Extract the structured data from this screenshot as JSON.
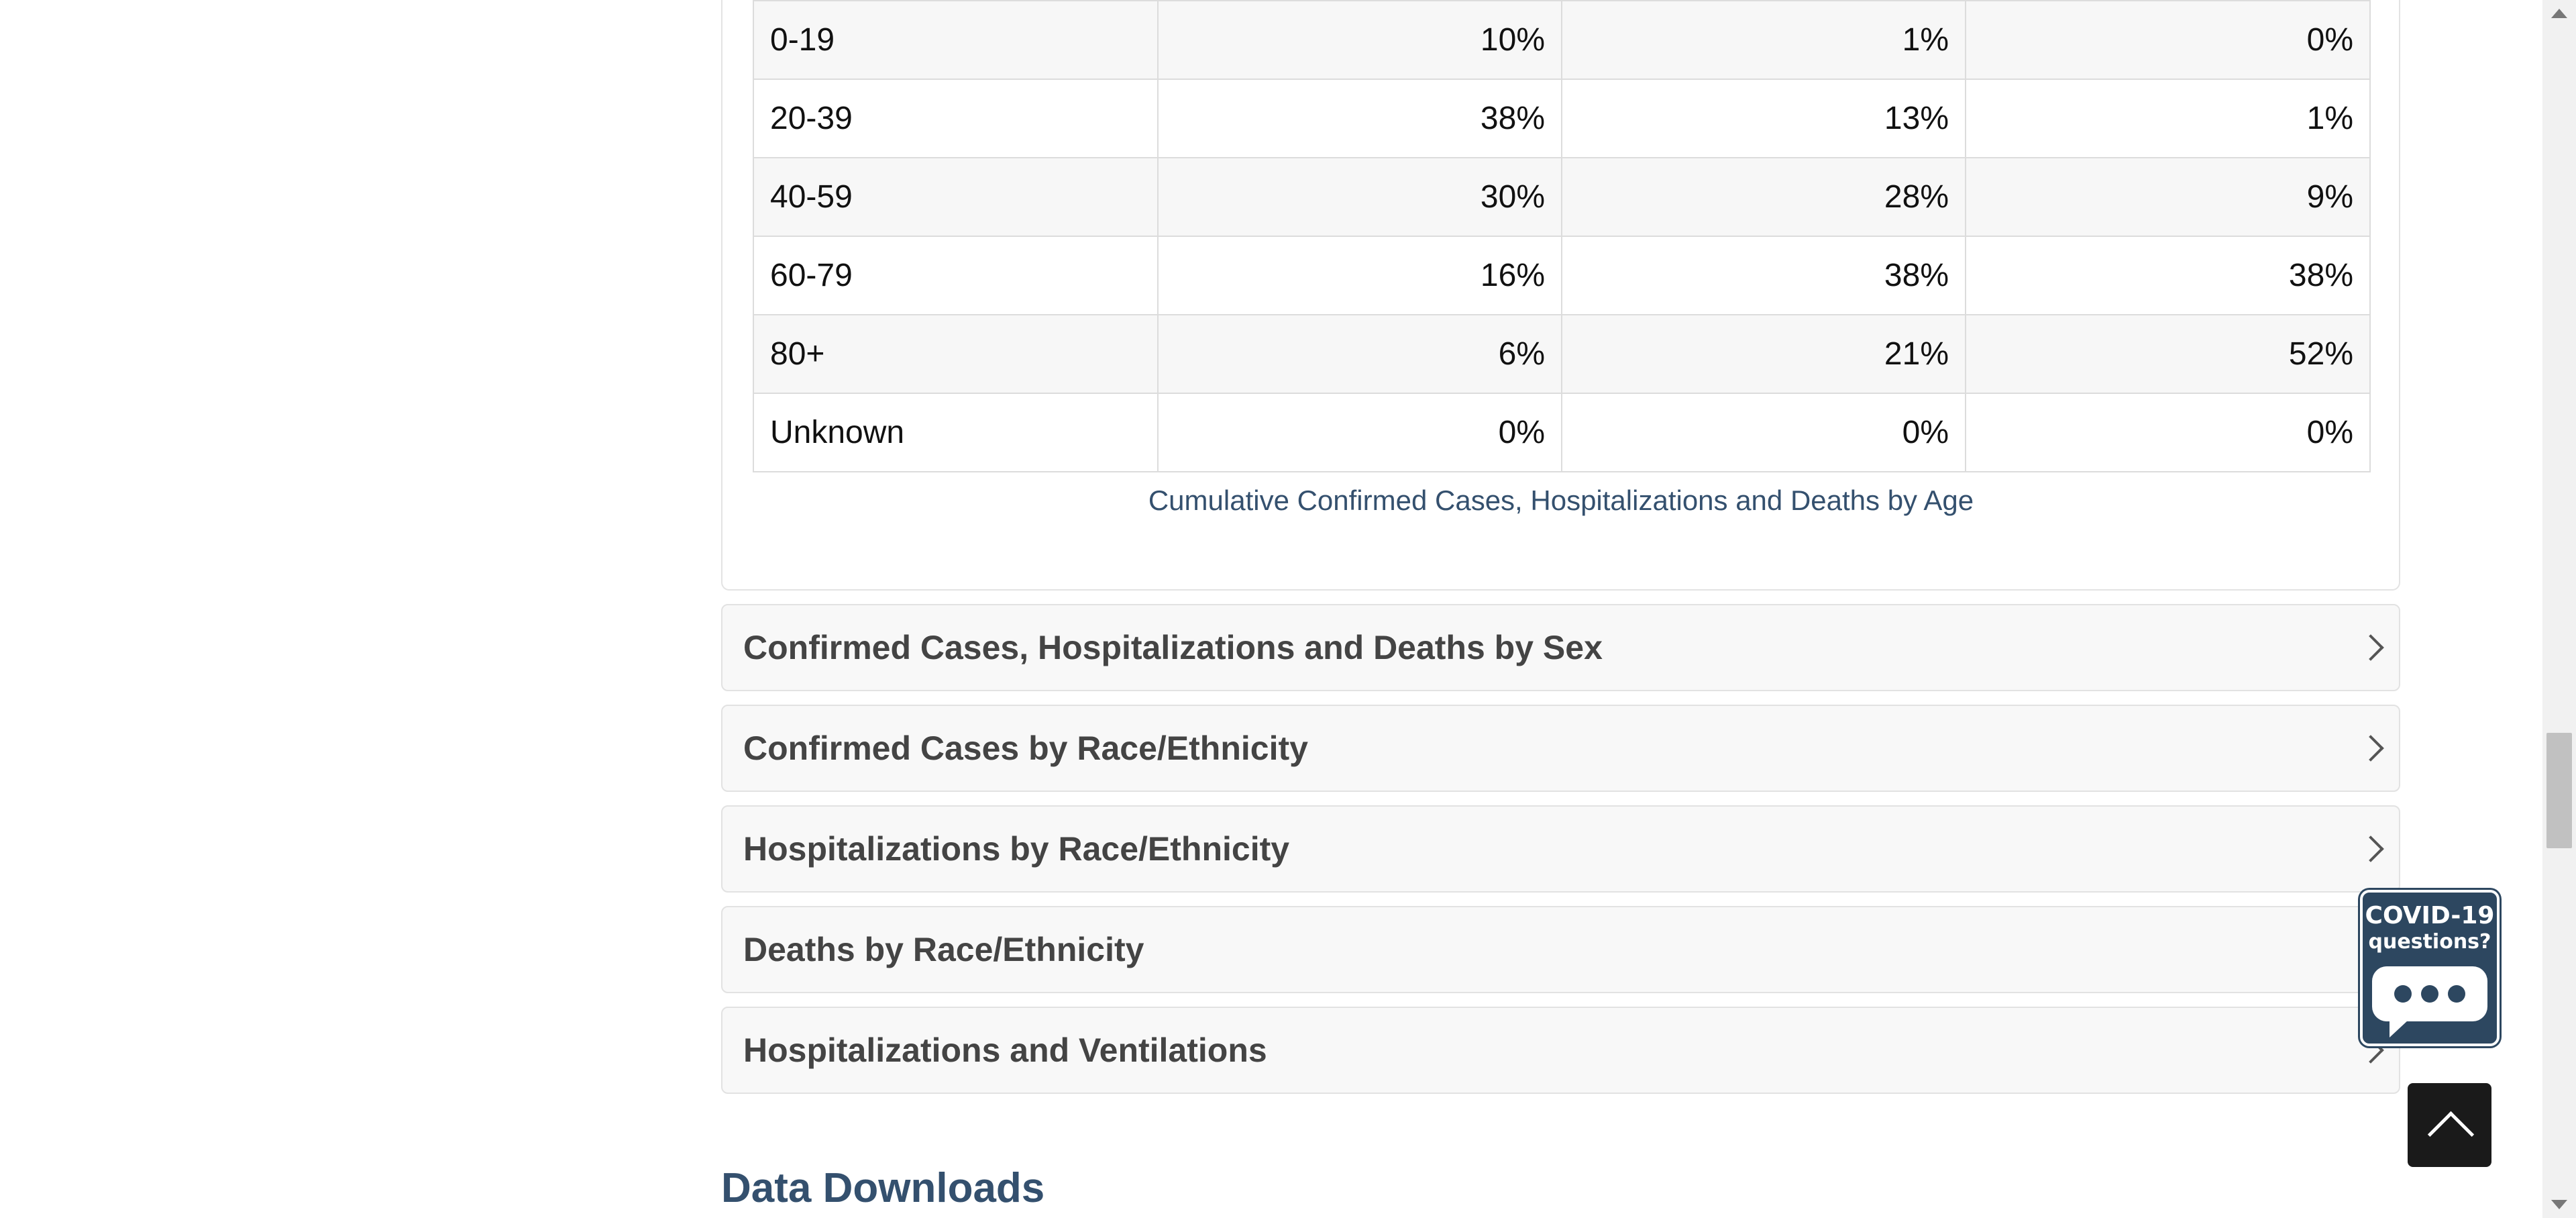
{
  "age_table": {
    "rows": [
      {
        "age": "0-19",
        "cases": "10%",
        "hospitalizations": "1%",
        "deaths": "0%"
      },
      {
        "age": "20-39",
        "cases": "38%",
        "hospitalizations": "13%",
        "deaths": "1%"
      },
      {
        "age": "40-59",
        "cases": "30%",
        "hospitalizations": "28%",
        "deaths": "9%"
      },
      {
        "age": "60-79",
        "cases": "16%",
        "hospitalizations": "38%",
        "deaths": "38%"
      },
      {
        "age": "80+",
        "cases": "6%",
        "hospitalizations": "21%",
        "deaths": "52%"
      },
      {
        "age": "Unknown",
        "cases": "0%",
        "hospitalizations": "0%",
        "deaths": "0%"
      }
    ],
    "caption": "Cumulative Confirmed Cases, Hospitalizations and Deaths by Age"
  },
  "accordions": [
    {
      "title": "Confirmed Cases, Hospitalizations and Deaths by Sex",
      "icon": "chevron-right-icon"
    },
    {
      "title": "Confirmed Cases by Race/Ethnicity",
      "icon": "chevron-right-icon"
    },
    {
      "title": "Hospitalizations by Race/Ethnicity",
      "icon": "chevron-right-icon"
    },
    {
      "title": "Deaths by Race/Ethnicity",
      "icon": "chevron-right-icon"
    },
    {
      "title": "Hospitalizations and Ventilations",
      "icon": "chevron-right-icon"
    }
  ],
  "section_heading": "Data Downloads",
  "chat_widget": {
    "line1": "COVID-19",
    "line2": "questions?",
    "icon": "chat-bubble-icon"
  },
  "back_to_top": {
    "icon": "chevron-up-icon"
  },
  "colors": {
    "heading": "#34506e",
    "chat_bg": "#2d4760",
    "back_to_top_bg": "#1a1a1a"
  }
}
